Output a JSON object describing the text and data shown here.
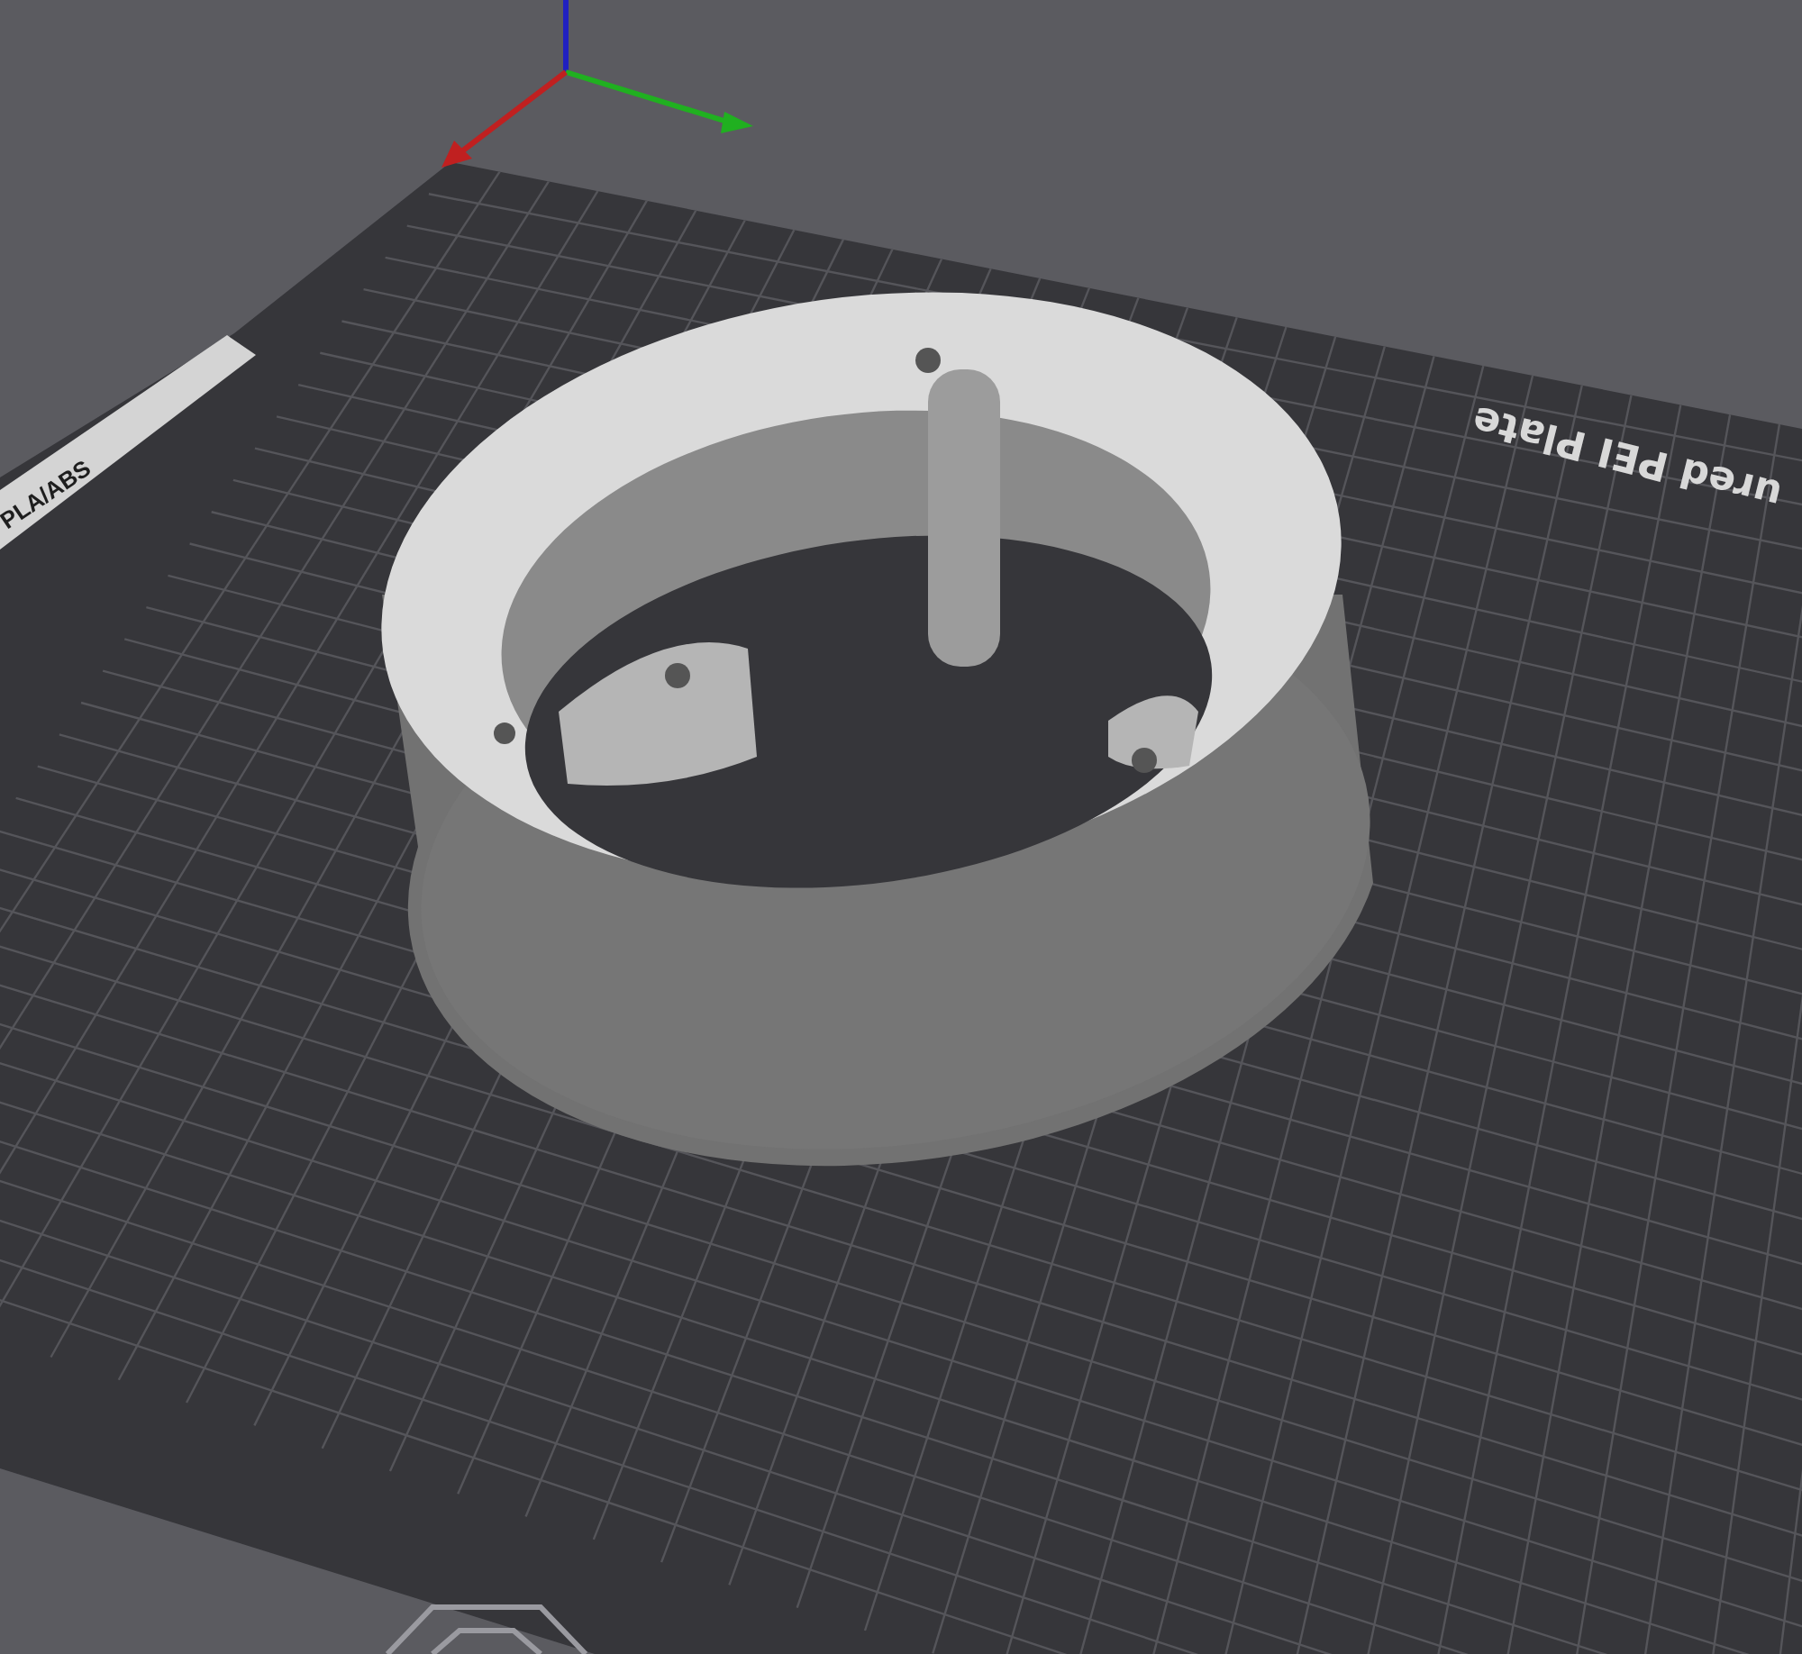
{
  "viewport": {
    "bed_label": "ured PEI Plate",
    "side_label": "PLA/ABS"
  }
}
